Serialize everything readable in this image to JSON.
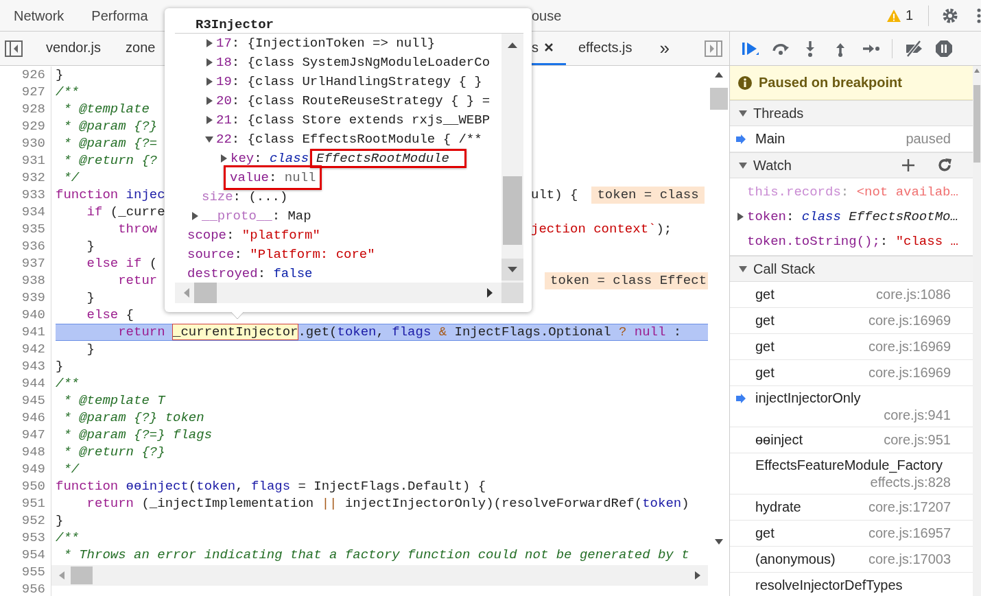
{
  "top_tabs_left": [
    {
      "label": "Network",
      "selected": false
    },
    {
      "label": "Performa",
      "selected": false
    }
  ],
  "top_tabs_right": [
    {
      "label": "ouse",
      "selected": false
    }
  ],
  "warnings": {
    "count": "1"
  },
  "file_tabs_left": [
    {
      "label": "vendor.js",
      "selected": false,
      "closable": false
    },
    {
      "label": "zone",
      "selected": false,
      "closable": false
    }
  ],
  "file_tabs_right": [
    {
      "label": "s",
      "selected": true,
      "closable": true
    },
    {
      "label": "effects.js",
      "selected": false,
      "closable": false
    }
  ],
  "file_tabs_more": "»",
  "editor": {
    "lines": [
      {
        "number": "926",
        "current": false,
        "code": [
          {
            "kind": "plain",
            "text": "}"
          }
        ]
      },
      {
        "number": "927",
        "current": false,
        "code": [
          {
            "kind": "com",
            "text": "/**"
          }
        ]
      },
      {
        "number": "928",
        "current": false,
        "code": [
          {
            "kind": "com",
            "text": " * @template"
          }
        ]
      },
      {
        "number": "929",
        "current": false,
        "code": [
          {
            "kind": "com",
            "text": " * @param {?}"
          }
        ]
      },
      {
        "number": "930",
        "current": false,
        "code": [
          {
            "kind": "com",
            "text": " * @param {?="
          }
        ]
      },
      {
        "number": "931",
        "current": false,
        "code": [
          {
            "kind": "com",
            "text": " * @return {?"
          }
        ]
      },
      {
        "number": "932",
        "current": false,
        "code": [
          {
            "kind": "com",
            "text": " */"
          }
        ]
      },
      {
        "number": "933",
        "current": false,
        "code": [
          {
            "kind": "kw",
            "text": "function"
          },
          {
            "kind": "var",
            "text": " injec"
          }
        ],
        "after": [
          {
            "kind": "plain",
            "text": "ult) {"
          },
          {
            "kind": "hint",
            "text": "token = class"
          }
        ]
      },
      {
        "number": "934",
        "current": false,
        "code": [
          {
            "kind": "kw",
            "text": "    if"
          },
          {
            "kind": "plain",
            "text": " (_curre"
          }
        ]
      },
      {
        "number": "935",
        "current": false,
        "code": [
          {
            "kind": "kw",
            "text": "        throw"
          }
        ],
        "after": [
          {
            "kind": "str",
            "text": "jection context`"
          },
          {
            "kind": "plain",
            "text": ");"
          }
        ]
      },
      {
        "number": "936",
        "current": false,
        "code": [
          {
            "kind": "plain",
            "text": "    }"
          }
        ]
      },
      {
        "number": "937",
        "current": false,
        "code": [
          {
            "kind": "kw",
            "text": "    else if"
          },
          {
            "kind": "plain",
            "text": " ("
          }
        ]
      },
      {
        "number": "938",
        "current": false,
        "code": [
          {
            "kind": "kw",
            "text": "        retur"
          }
        ],
        "after": [
          {
            "kind": "hint",
            "text": "token = class Effect"
          }
        ]
      },
      {
        "number": "939",
        "current": false,
        "code": [
          {
            "kind": "plain",
            "text": "    }"
          }
        ]
      },
      {
        "number": "940",
        "current": false,
        "code": [
          {
            "kind": "kw",
            "text": "    else"
          },
          {
            "kind": "plain",
            "text": " {"
          }
        ]
      },
      {
        "number": "941",
        "current": true,
        "code": [
          {
            "kind": "kw",
            "text": "        return "
          },
          {
            "kind": "hover",
            "text": "_currentInjector"
          },
          {
            "kind": "plain",
            "text": ".get("
          },
          {
            "kind": "var",
            "text": "token"
          },
          {
            "kind": "plain",
            "text": ", "
          },
          {
            "kind": "var",
            "text": "flags"
          },
          {
            "kind": "op",
            "text": " &"
          },
          {
            "kind": "plain",
            "text": " InjectFlags.Optional"
          },
          {
            "kind": "op",
            "text": " ?"
          },
          {
            "kind": "kw",
            "text": " null"
          },
          {
            "kind": "plain",
            "text": " :"
          }
        ]
      },
      {
        "number": "942",
        "current": false,
        "code": [
          {
            "kind": "plain",
            "text": "    }"
          }
        ]
      },
      {
        "number": "943",
        "current": false,
        "code": [
          {
            "kind": "plain",
            "text": "}"
          }
        ]
      },
      {
        "number": "944",
        "current": false,
        "code": [
          {
            "kind": "com",
            "text": "/**"
          }
        ]
      },
      {
        "number": "945",
        "current": false,
        "code": [
          {
            "kind": "com",
            "text": " * @template T"
          }
        ]
      },
      {
        "number": "946",
        "current": false,
        "code": [
          {
            "kind": "com",
            "text": " * @param {?} token"
          }
        ]
      },
      {
        "number": "947",
        "current": false,
        "code": [
          {
            "kind": "com",
            "text": " * @param {?=} flags"
          }
        ]
      },
      {
        "number": "948",
        "current": false,
        "code": [
          {
            "kind": "com",
            "text": " * @return {?}"
          }
        ]
      },
      {
        "number": "949",
        "current": false,
        "code": [
          {
            "kind": "com",
            "text": " */"
          }
        ]
      },
      {
        "number": "950",
        "current": false,
        "code": [
          {
            "kind": "kw",
            "text": "function"
          },
          {
            "kind": "var",
            "text": " ɵɵinject"
          },
          {
            "kind": "plain",
            "text": "("
          },
          {
            "kind": "var",
            "text": "token"
          },
          {
            "kind": "plain",
            "text": ", "
          },
          {
            "kind": "var",
            "text": "flags"
          },
          {
            "kind": "plain",
            "text": " = InjectFlags.Default) {"
          }
        ]
      },
      {
        "number": "951",
        "current": false,
        "code": [
          {
            "kind": "kw",
            "text": "    return"
          },
          {
            "kind": "plain",
            "text": " (_injectImplementation"
          },
          {
            "kind": "op",
            "text": " ||"
          },
          {
            "kind": "plain",
            "text": " injectInjectorOnly)(resolveForwardRef("
          },
          {
            "kind": "var",
            "text": "token"
          },
          {
            "kind": "plain",
            "text": ")"
          }
        ]
      },
      {
        "number": "952",
        "current": false,
        "code": [
          {
            "kind": "plain",
            "text": "}"
          }
        ]
      },
      {
        "number": "953",
        "current": false,
        "code": [
          {
            "kind": "com",
            "text": "/**"
          }
        ]
      },
      {
        "number": "954",
        "current": false,
        "code": [
          {
            "kind": "com",
            "text": " * Throws an error indicating that a factory function could not be generated by t"
          }
        ]
      }
    ],
    "hidden_line_numbers": [
      "955",
      "956"
    ]
  },
  "popup": {
    "title": "R3Injector",
    "tree": [
      {
        "children": [
          {
            "children": [
              {
                "parts": [
                  {
                    "kind": "index",
                    "text": "17"
                  },
                  {
                    "kind": "plain",
                    "text": ": {InjectionToken => null}"
                  }
                ],
                "expanded": false,
                "boxed": false
              },
              {
                "parts": [
                  {
                    "kind": "index",
                    "text": "18"
                  },
                  {
                    "kind": "plain",
                    "text": ": {class SystemJsNgModuleLoaderCo"
                  }
                ],
                "expanded": false,
                "boxed": false
              },
              {
                "parts": [
                  {
                    "kind": "index",
                    "text": "19"
                  },
                  {
                    "kind": "plain",
                    "text": ": {class UrlHandlingStrategy { }"
                  }
                ],
                "expanded": false,
                "boxed": false
              },
              {
                "parts": [
                  {
                    "kind": "index",
                    "text": "20"
                  },
                  {
                    "kind": "plain",
                    "text": ": {class RouteReuseStrategy { } ="
                  }
                ],
                "expanded": false,
                "boxed": false
              },
              {
                "parts": [
                  {
                    "kind": "index",
                    "text": "21"
                  },
                  {
                    "kind": "plain",
                    "text": ": {class Store extends rxjs__WEBP"
                  }
                ],
                "expanded": false,
                "boxed": false
              },
              {
                "parts": [
                  {
                    "kind": "index",
                    "text": "22"
                  },
                  {
                    "kind": "plain",
                    "text": ": {class EffectsRootModule { /**"
                  }
                ],
                "expanded": true,
                "boxed": false,
                "children": [
                  {
                    "parts": [
                      {
                        "kind": "prop",
                        "text": "key"
                      },
                      {
                        "kind": "plain",
                        "text": ": "
                      },
                      {
                        "kind": "kwi",
                        "text": "class"
                      },
                      {
                        "kind": "boxi",
                        "text": "EffectsRootModule"
                      }
                    ],
                    "expanded": false,
                    "boxed": false
                  },
                  {
                    "parts": [
                      {
                        "kind": "prop",
                        "text": "value"
                      },
                      {
                        "kind": "plain",
                        "text": ": "
                      },
                      {
                        "kind": "nul",
                        "text": "null"
                      }
                    ],
                    "boxed": true
                  }
                ]
              }
            ]
          },
          {
            "parts": [
              {
                "kind": "dim",
                "text": "size"
              },
              {
                "kind": "plain",
                "text": ": (...)"
              }
            ],
            "boxed": false
          },
          {
            "parts": [
              {
                "kind": "dim",
                "text": "__proto__"
              },
              {
                "kind": "plain",
                "text": ": Map"
              }
            ],
            "expanded": false,
            "boxed": false
          }
        ]
      },
      {
        "parts": [
          {
            "kind": "prop",
            "text": "scope"
          },
          {
            "kind": "plain",
            "text": ": "
          },
          {
            "kind": "str",
            "text": "\"platform\""
          }
        ],
        "boxed": false
      },
      {
        "parts": [
          {
            "kind": "prop",
            "text": "source"
          },
          {
            "kind": "plain",
            "text": ": "
          },
          {
            "kind": "str",
            "text": "\"Platform: core\""
          }
        ],
        "boxed": false
      },
      {
        "parts": [
          {
            "kind": "prop",
            "text": "destroyed"
          },
          {
            "kind": "plain",
            "text": ": "
          },
          {
            "kind": "bool",
            "text": "false"
          }
        ],
        "boxed": false
      }
    ]
  },
  "debugger": {
    "status": "Paused on breakpoint",
    "threads": {
      "title": "Threads",
      "expanded": true,
      "items": [
        {
          "name": "Main",
          "state": "paused",
          "selected": true
        }
      ]
    },
    "watch": {
      "title": "Watch",
      "expanded": true,
      "items": [
        {
          "parts": [
            {
              "kind": "dimprop",
              "text": "this.records"
            },
            {
              "kind": "dimplain",
              "text": ": "
            },
            {
              "kind": "err",
              "text": "<not availab…"
            }
          ]
        },
        {
          "parts": [
            {
              "kind": "prop",
              "text": "token"
            },
            {
              "kind": "plain",
              "text": ": "
            },
            {
              "kind": "kwi",
              "text": "class"
            },
            {
              "kind": "ital",
              "text": " EffectsRootMo…"
            }
          ],
          "expanded": false
        },
        {
          "parts": [
            {
              "kind": "prop",
              "text": "token.toString();"
            },
            {
              "kind": "plain",
              "text": ": "
            },
            {
              "kind": "str",
              "text": "\"class …"
            }
          ]
        }
      ]
    },
    "call_stack": {
      "title": "Call Stack",
      "expanded": true,
      "frames": [
        {
          "name": "get",
          "location": "core.js:1086",
          "selected": false,
          "kind": "inline"
        },
        {
          "name": "get",
          "location": "core.js:16969",
          "selected": false,
          "kind": "inline"
        },
        {
          "name": "get",
          "location": "core.js:16969",
          "selected": false,
          "kind": "inline"
        },
        {
          "name": "get",
          "location": "core.js:16969",
          "selected": false,
          "kind": "inline"
        },
        {
          "name": "injectInjectorOnly",
          "location": "core.js:941",
          "selected": true,
          "kind": "wrapped"
        },
        {
          "name": "ɵɵinject",
          "location": "core.js:951",
          "selected": false,
          "kind": "inline"
        },
        {
          "name": "EffectsFeatureModule_Factory",
          "location": "effects.js:828",
          "selected": false,
          "kind": "wrapped"
        },
        {
          "name": "hydrate",
          "location": "core.js:17207",
          "selected": false,
          "kind": "inline"
        },
        {
          "name": "get",
          "location": "core.js:16957",
          "selected": false,
          "kind": "inline"
        },
        {
          "name": "(anonymous)",
          "location": "core.js:17003",
          "selected": false,
          "kind": "inline"
        },
        {
          "name": "resolveInjectorDefTypes",
          "selected": false,
          "kind": "inline"
        }
      ]
    }
  }
}
